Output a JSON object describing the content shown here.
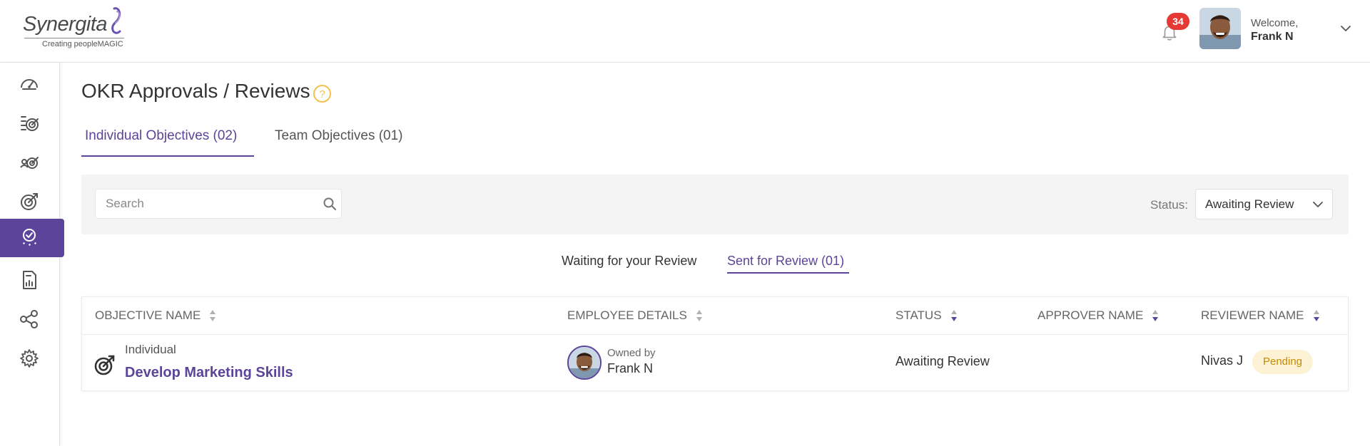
{
  "header": {
    "logo_text": "Synergita",
    "logo_tagline": "Creating peopleMAGIC",
    "notifications_count": "34",
    "welcome_label": "Welcome,",
    "user_name": "Frank N"
  },
  "sidebar": {
    "items": [
      {
        "icon": "dashboard-icon"
      },
      {
        "icon": "objectives-list-icon"
      },
      {
        "icon": "team-objectives-icon"
      },
      {
        "icon": "target-icon"
      },
      {
        "icon": "approvals-icon",
        "active": true
      },
      {
        "icon": "reports-icon"
      },
      {
        "icon": "alignment-icon"
      },
      {
        "icon": "settings-icon"
      }
    ]
  },
  "page": {
    "title": "OKR Approvals / Reviews",
    "tabs": [
      {
        "label": "Individual Objectives (02)",
        "active": true
      },
      {
        "label": "Team Objectives (01)",
        "active": false
      }
    ]
  },
  "filters": {
    "search_placeholder": "Search",
    "search_value": "",
    "status_label": "Status:",
    "status_value": "Awaiting Review"
  },
  "subtabs": [
    {
      "label": "Waiting for your Review",
      "active": false
    },
    {
      "label": "Sent for Review (01)",
      "active": true
    }
  ],
  "table": {
    "columns": [
      "OBJECTIVE NAME",
      "EMPLOYEE DETAILS",
      "STATUS",
      "APPROVER NAME",
      "REVIEWER NAME"
    ],
    "rows": [
      {
        "type": "Individual",
        "objective": "Develop Marketing Skills",
        "owned_by_label": "Owned by",
        "employee": "Frank N",
        "status": "Awaiting Review",
        "approver": "",
        "reviewer": "Nivas J",
        "reviewer_status": "Pending"
      }
    ]
  },
  "colors": {
    "accent": "#5b449a",
    "badge": "#e53935",
    "pending_bg": "#fdf3d4",
    "pending_text": "#c28b00",
    "help": "#f2c14e"
  }
}
